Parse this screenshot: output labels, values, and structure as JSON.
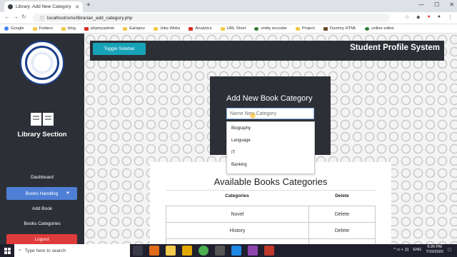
{
  "browser": {
    "tab_title": "Library: Add New Category",
    "url": "localhost/sms/librarian_add_category.php",
    "bookmarks": [
      "Google",
      "Folders",
      "blog",
      "phpmyadmin",
      "Eartqnui",
      "Jobs Webs",
      "Analytics",
      "URL Short",
      "entity encoder",
      "Project",
      "Dummy HTML",
      "online editor"
    ]
  },
  "sidebar": {
    "title": "Library Section",
    "items": {
      "dashboard": "Dashboard",
      "books_handling": "Books Handling",
      "add_book": "Add Book",
      "books_categories": "Books Categories",
      "logout": "Logout"
    }
  },
  "header": {
    "toggle_label": "Toggle Sidebar",
    "system_title": "Student Profile System"
  },
  "form": {
    "title": "Add New Book Category",
    "placeholder": "Name New Category",
    "suggestions": [
      "Biography",
      "Language",
      "IT",
      "Banking"
    ]
  },
  "categories_table": {
    "title": "Available Books Categories",
    "headers": {
      "category": "Categories",
      "delete": "Delete"
    },
    "rows": [
      {
        "category": "Novel",
        "action": "Delete"
      },
      {
        "category": "History",
        "action": "Delete"
      }
    ]
  },
  "taskbar": {
    "search_placeholder": "Type here to search",
    "lang": "ENG",
    "time": "6:26 PM",
    "date": "7/15/2020"
  },
  "colors": {
    "sidebar_bg": "#2c3036",
    "active_item": "#4f7fd6",
    "logout": "#e03b3b",
    "toggle_btn": "#17a2b8"
  }
}
